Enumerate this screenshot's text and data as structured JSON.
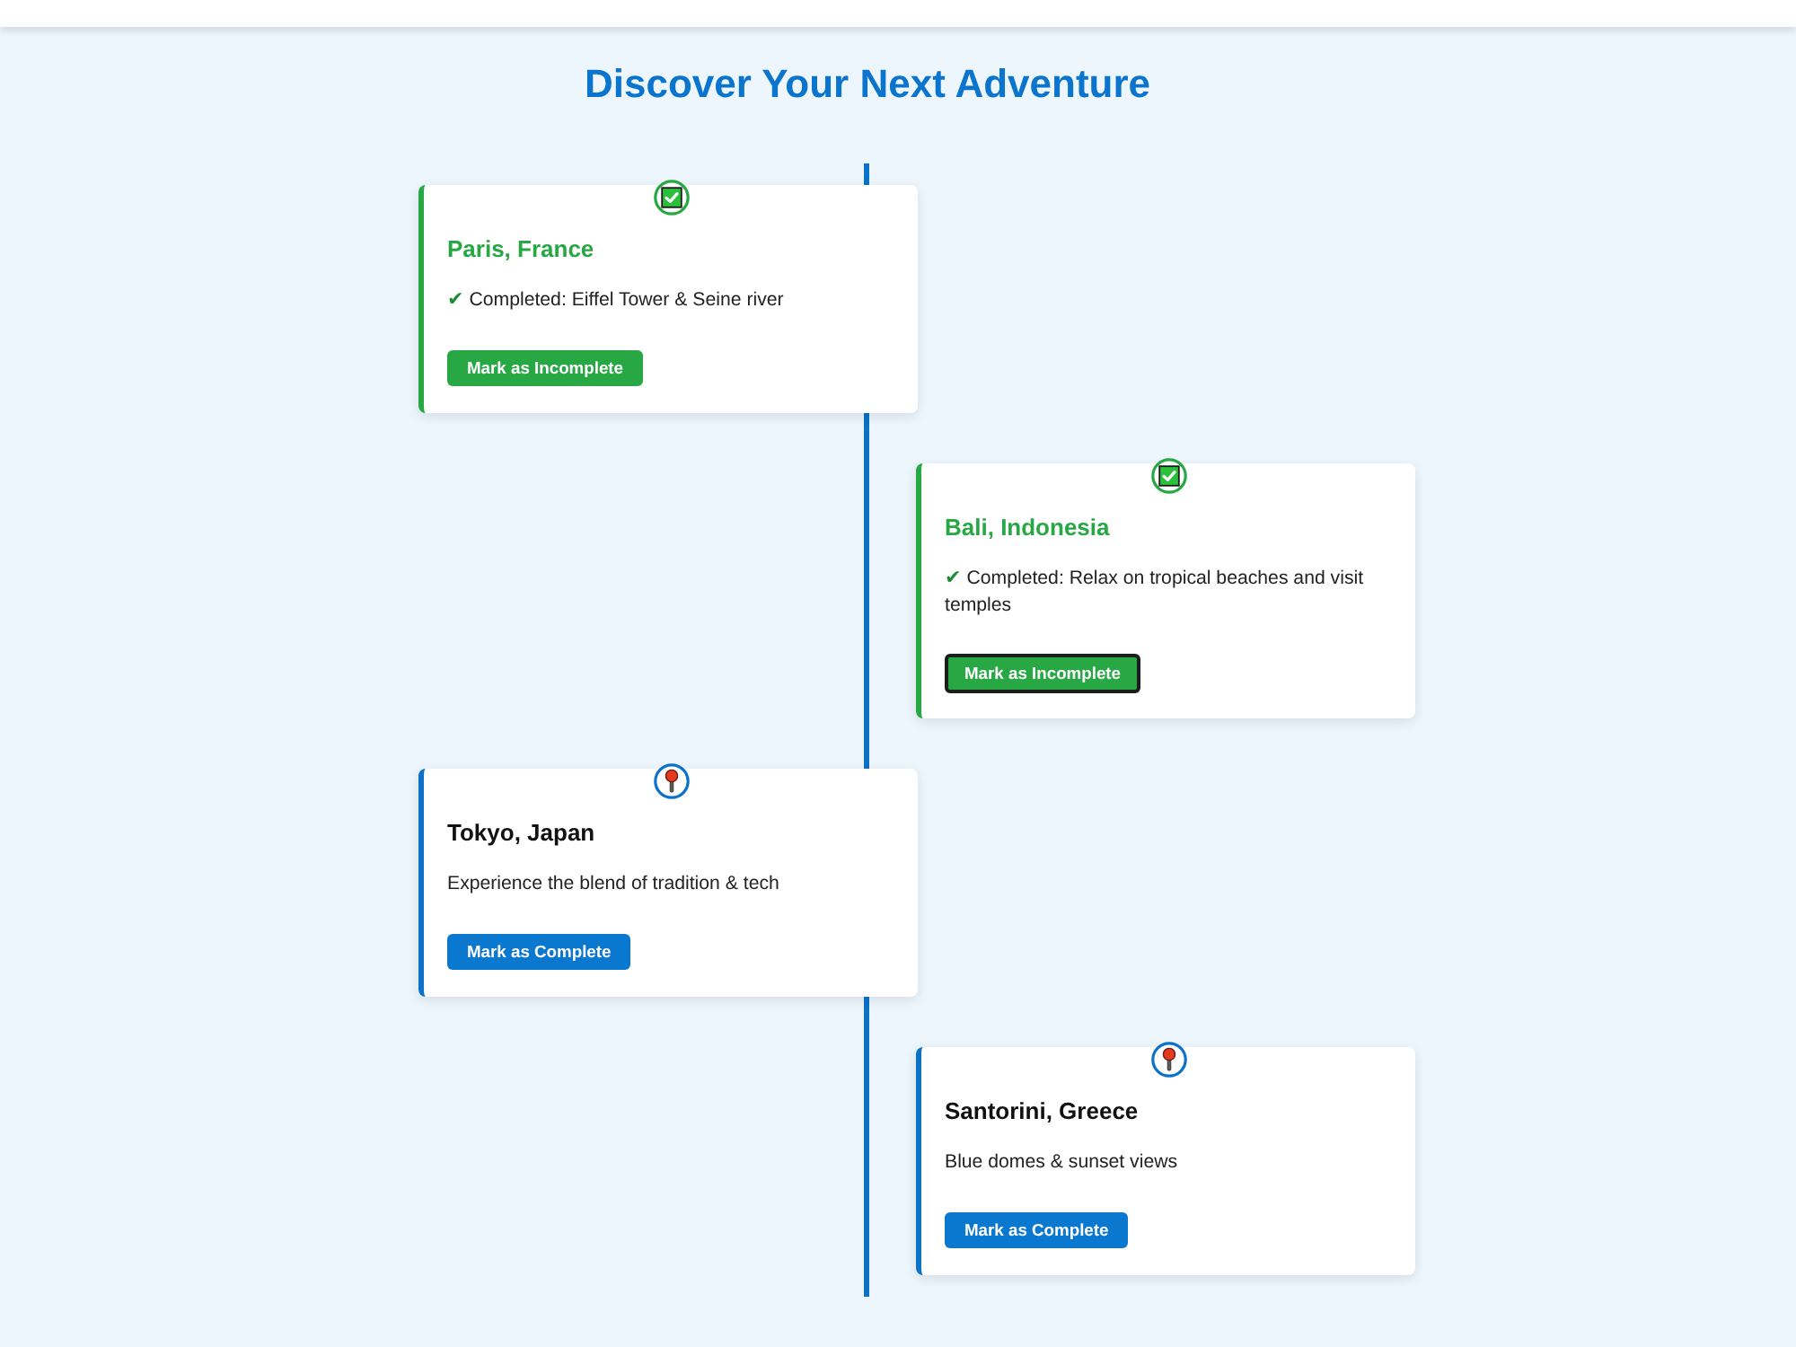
{
  "page_title": "Discover Your Next Adventure",
  "destinations": [
    {
      "name": "Paris, France",
      "completed": true,
      "mark": "✔",
      "description": "Completed: Eiffel Tower & Seine river",
      "button": "Mark as Incomplete",
      "focused": false
    },
    {
      "name": "Bali, Indonesia",
      "completed": true,
      "mark": "✔",
      "description": "Completed: Relax on tropical beaches and visit temples",
      "button": "Mark as Incomplete",
      "focused": true
    },
    {
      "name": "Tokyo, Japan",
      "completed": false,
      "description": "Experience the blend of tradition & tech",
      "button": "Mark as Complete",
      "focused": false
    },
    {
      "name": "Santorini, Greece",
      "completed": false,
      "description": "Blue domes & sunset views",
      "button": "Mark as Complete",
      "focused": false
    }
  ]
}
